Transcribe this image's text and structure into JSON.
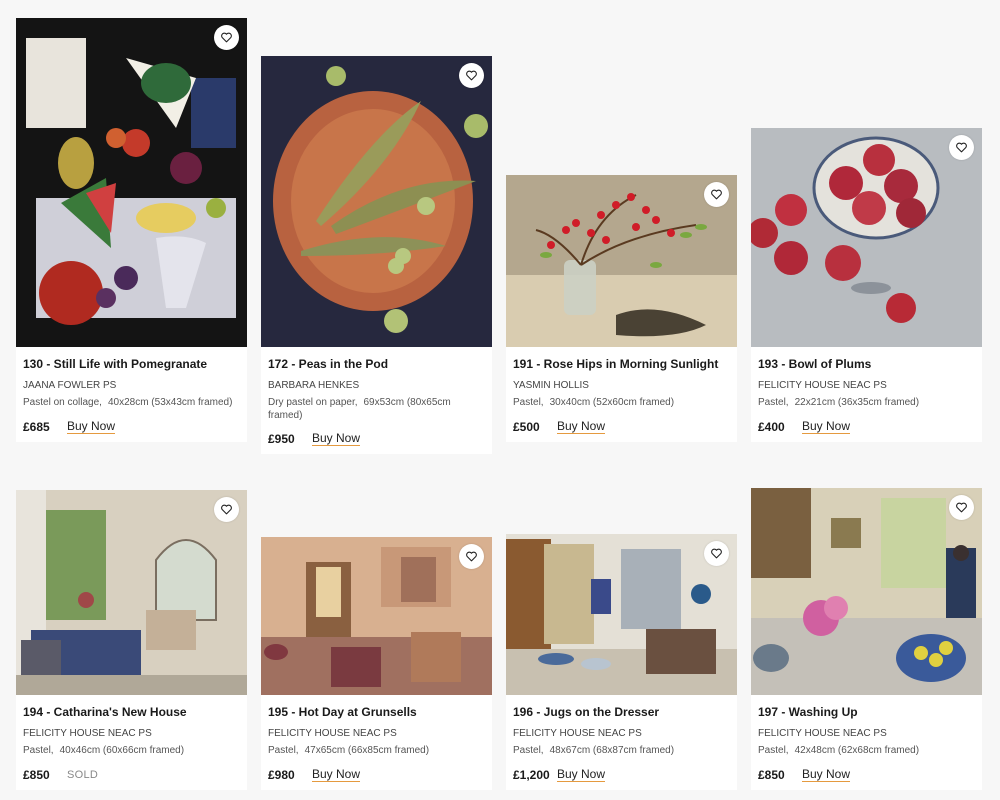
{
  "cards": [
    {
      "title": "130 - Still Life with Pomegranate",
      "artist": "JAANA FOWLER PS",
      "medium": "Pastel on collage,",
      "size": "40x28cm (53x43cm framed)",
      "price": "£685",
      "action": "Buy Now"
    },
    {
      "title": "172 - Peas in the Pod",
      "artist": "BARBARA HENKES",
      "medium": "Dry pastel on paper,",
      "size": "69x53cm (80x65cm framed)",
      "price": "£950",
      "action": "Buy Now"
    },
    {
      "title": "191 - Rose Hips in Morning Sunlight",
      "artist": "YASMIN HOLLIS",
      "medium": "Pastel,",
      "size": "30x40cm (52x60cm framed)",
      "price": "£500",
      "action": "Buy Now"
    },
    {
      "title": "193 - Bowl of Plums",
      "artist": "FELICITY HOUSE NEAC PS",
      "medium": "Pastel,",
      "size": "22x21cm (36x35cm framed)",
      "price": "£400",
      "action": "Buy Now"
    },
    {
      "title": "194 - Catharina's New House",
      "artist": "FELICITY HOUSE NEAC PS",
      "medium": "Pastel,",
      "size": "40x46cm (60x66cm framed)",
      "price": "£850",
      "action": "SOLD"
    },
    {
      "title": "195 - Hot Day at Grunsells",
      "artist": "FELICITY HOUSE NEAC PS",
      "medium": "Pastel,",
      "size": "47x65cm (66x85cm framed)",
      "price": "£980",
      "action": "Buy Now"
    },
    {
      "title": "196 - Jugs on the Dresser",
      "artist": "FELICITY HOUSE NEAC PS",
      "medium": "Pastel,",
      "size": "48x67cm (68x87cm framed)",
      "price": "£1,200",
      "action": "Buy Now"
    },
    {
      "title": "197 - Washing Up",
      "artist": "FELICITY HOUSE NEAC PS",
      "medium": "Pastel,",
      "size": "42x48cm (62x68cm framed)",
      "price": "£850",
      "action": "Buy Now"
    }
  ],
  "icons": {
    "favorite": "heart-outline-icon"
  }
}
